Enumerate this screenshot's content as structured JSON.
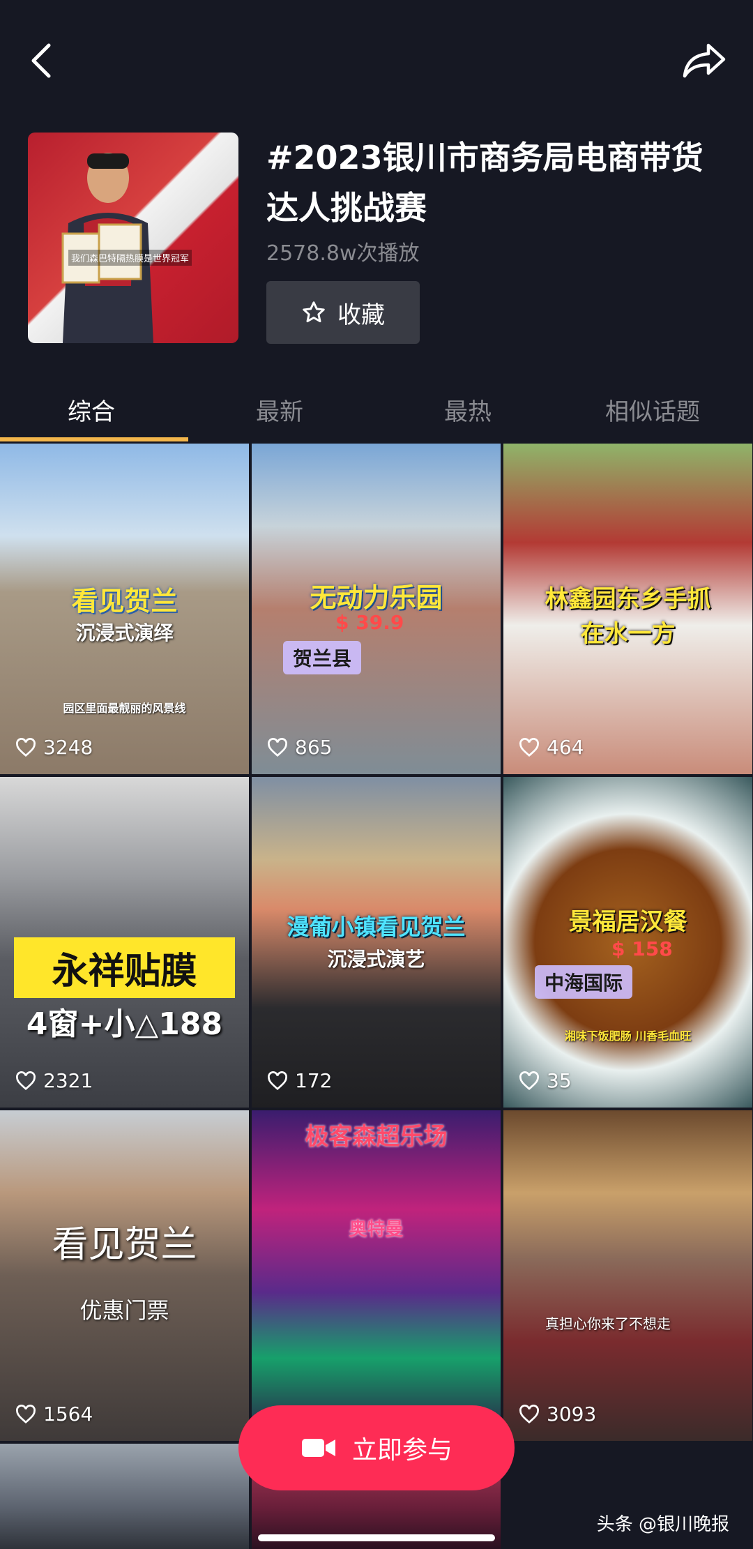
{
  "topbar": {
    "back_icon": "chevron-left-icon",
    "share_icon": "share-arrow-icon"
  },
  "topic": {
    "title": "#2023银川市商务局电商带货达人挑战赛",
    "plays": "2578.8w次播放",
    "favorite_label": "收藏",
    "cover_caption": "我们森巴特隔热膜是世界冠军"
  },
  "tabs": [
    {
      "label": "综合",
      "active": true
    },
    {
      "label": "最新",
      "active": false
    },
    {
      "label": "最热",
      "active": false
    },
    {
      "label": "相似话题",
      "active": false
    }
  ],
  "videos": [
    {
      "caption": "看见贺兰",
      "sub": "沉浸式演绎",
      "note": "园区里面最靓丽的风景线",
      "likes": "3248"
    },
    {
      "caption": "无动力乐园",
      "price": "39.9",
      "tag": "贺兰县",
      "likes": "865"
    },
    {
      "caption": "林鑫园东乡手抓",
      "caption2": "在水一方",
      "likes": "464"
    },
    {
      "caption": "永祥贴膜",
      "sub": "4窗+小△188",
      "likes": "2321"
    },
    {
      "caption": "漫葡小镇看见贺兰",
      "sub": "沉浸式演艺",
      "likes": "172"
    },
    {
      "caption": "景福居汉餐",
      "price": "158",
      "tag": "中海国际",
      "note": "湘味下饭肥肠 川香毛血旺",
      "likes": "35"
    },
    {
      "caption": "看见贺兰",
      "sub": "优惠门票",
      "likes": "1564"
    },
    {
      "caption": "极客森超乐场",
      "sub": "奥特曼",
      "likes": ""
    },
    {
      "caption": "真担心你来了不想走",
      "likes": "3093"
    }
  ],
  "join_button": {
    "label": "立即参与",
    "icon": "video-camera-icon"
  },
  "watermark": "头条 @银川晚报",
  "colors": {
    "accent": "#fe2c55",
    "tab_indicator": "#f3b64b",
    "background": "#161823"
  }
}
